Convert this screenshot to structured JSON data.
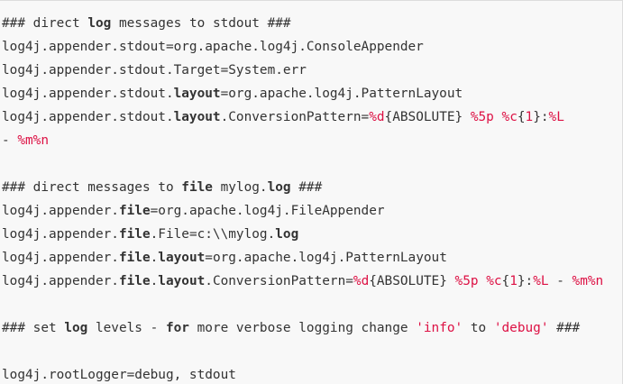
{
  "code_lines": [
    [
      {
        "text": "### direct ",
        "type": "plain"
      },
      {
        "text": "log",
        "type": "keyword"
      },
      {
        "text": " messages to stdout ###",
        "type": "plain"
      }
    ],
    [
      {
        "text": "log4j.appender.stdout=org.apache.log4j.ConsoleAppender",
        "type": "plain"
      }
    ],
    [
      {
        "text": "log4j.appender.stdout.Target=System.err",
        "type": "plain"
      }
    ],
    [
      {
        "text": "log4j.appender.stdout.",
        "type": "plain"
      },
      {
        "text": "layout",
        "type": "keyword"
      },
      {
        "text": "=org.apache.log4j.PatternLayout",
        "type": "plain"
      }
    ],
    [
      {
        "text": "log4j.appender.stdout.",
        "type": "plain"
      },
      {
        "text": "layout",
        "type": "keyword"
      },
      {
        "text": ".ConversionPattern=",
        "type": "plain"
      },
      {
        "text": "%d",
        "type": "pattern"
      },
      {
        "text": "{ABSOLUTE} ",
        "type": "plain"
      },
      {
        "text": "%5p",
        "type": "pattern"
      },
      {
        "text": " ",
        "type": "plain"
      },
      {
        "text": "%c",
        "type": "pattern"
      },
      {
        "text": "{",
        "type": "plain"
      },
      {
        "text": "1",
        "type": "pattern"
      },
      {
        "text": "}:",
        "type": "plain"
      },
      {
        "text": "%L",
        "type": "pattern"
      }
    ],
    [
      {
        "text": "- ",
        "type": "plain"
      },
      {
        "text": "%m%n",
        "type": "pattern"
      }
    ],
    [],
    [
      {
        "text": "### direct messages to ",
        "type": "plain"
      },
      {
        "text": "file",
        "type": "keyword"
      },
      {
        "text": " mylog.",
        "type": "plain"
      },
      {
        "text": "log",
        "type": "keyword"
      },
      {
        "text": " ###",
        "type": "plain"
      }
    ],
    [
      {
        "text": "log4j.appender.",
        "type": "plain"
      },
      {
        "text": "file",
        "type": "keyword"
      },
      {
        "text": "=org.apache.log4j.FileAppender",
        "type": "plain"
      }
    ],
    [
      {
        "text": "log4j.appender.",
        "type": "plain"
      },
      {
        "text": "file",
        "type": "keyword"
      },
      {
        "text": ".File=c:\\\\mylog.",
        "type": "plain"
      },
      {
        "text": "log",
        "type": "keyword"
      }
    ],
    [
      {
        "text": "log4j.appender.",
        "type": "plain"
      },
      {
        "text": "file",
        "type": "keyword"
      },
      {
        "text": ".",
        "type": "plain"
      },
      {
        "text": "layout",
        "type": "keyword"
      },
      {
        "text": "=org.apache.log4j.PatternLayout",
        "type": "plain"
      }
    ],
    [
      {
        "text": "log4j.appender.",
        "type": "plain"
      },
      {
        "text": "file",
        "type": "keyword"
      },
      {
        "text": ".",
        "type": "plain"
      },
      {
        "text": "layout",
        "type": "keyword"
      },
      {
        "text": ".ConversionPattern=",
        "type": "plain"
      },
      {
        "text": "%d",
        "type": "pattern"
      },
      {
        "text": "{ABSOLUTE} ",
        "type": "plain"
      },
      {
        "text": "%5p",
        "type": "pattern"
      },
      {
        "text": " ",
        "type": "plain"
      },
      {
        "text": "%c",
        "type": "pattern"
      },
      {
        "text": "{",
        "type": "plain"
      },
      {
        "text": "1",
        "type": "pattern"
      },
      {
        "text": "}:",
        "type": "plain"
      },
      {
        "text": "%L",
        "type": "pattern"
      },
      {
        "text": " - ",
        "type": "plain"
      },
      {
        "text": "%m%n",
        "type": "pattern"
      }
    ],
    [],
    [
      {
        "text": "### set ",
        "type": "plain"
      },
      {
        "text": "log",
        "type": "keyword"
      },
      {
        "text": " levels - ",
        "type": "plain"
      },
      {
        "text": "for",
        "type": "keyword"
      },
      {
        "text": " more verbose logging change ",
        "type": "plain"
      },
      {
        "text": "'info'",
        "type": "string"
      },
      {
        "text": " to ",
        "type": "plain"
      },
      {
        "text": "'debug'",
        "type": "string"
      },
      {
        "text": " ###",
        "type": "plain"
      }
    ],
    [],
    [
      {
        "text": "log4j.rootLogger=debug, stdout",
        "type": "plain"
      }
    ]
  ],
  "colors": {
    "background": "#f8f8f8",
    "text": "#333333",
    "string": "#dd1144",
    "pattern": "#dd1144"
  }
}
